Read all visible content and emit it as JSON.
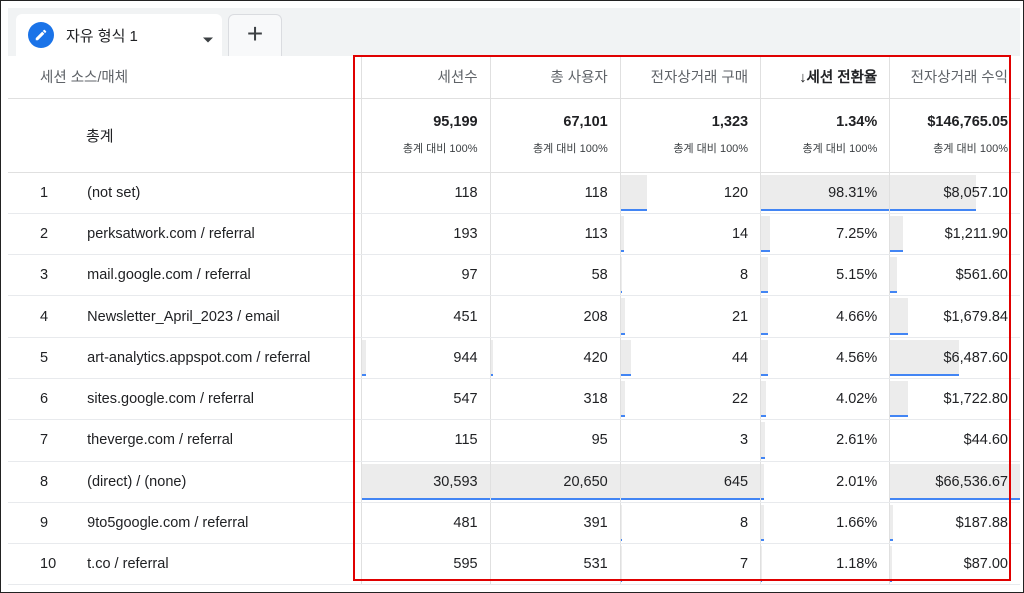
{
  "tab": {
    "label": "자유 형식 1",
    "icon": "pencil-icon",
    "add_icon": "plus-icon"
  },
  "columns": {
    "source": "세션 소스/매체",
    "sessions": "세션수",
    "users": "총 사용자",
    "purchases": "전자상거래 구매",
    "conversion": "↓세션 전환율",
    "revenue": "전자상거래 수익"
  },
  "totals": {
    "label": "총계",
    "sessions": "95,199",
    "users": "67,101",
    "purchases": "1,323",
    "conversion": "1.34%",
    "revenue": "$146,765.05",
    "sub": "총계 대비 100%"
  },
  "rows": [
    {
      "idx": "1",
      "source": "(not set)",
      "sessions": "118",
      "users": "118",
      "purchases": "120",
      "conversion": "98.31%",
      "revenue": "$8,057.10"
    },
    {
      "idx": "2",
      "source": "perksatwork.com / referral",
      "sessions": "193",
      "users": "113",
      "purchases": "14",
      "conversion": "7.25%",
      "revenue": "$1,211.90"
    },
    {
      "idx": "3",
      "source": "mail.google.com / referral",
      "sessions": "97",
      "users": "58",
      "purchases": "8",
      "conversion": "5.15%",
      "revenue": "$561.60"
    },
    {
      "idx": "4",
      "source": "Newsletter_April_2023 / email",
      "sessions": "451",
      "users": "208",
      "purchases": "21",
      "conversion": "4.66%",
      "revenue": "$1,679.84"
    },
    {
      "idx": "5",
      "source": "art-analytics.appspot.com / referral",
      "sessions": "944",
      "users": "420",
      "purchases": "44",
      "conversion": "4.56%",
      "revenue": "$6,487.60"
    },
    {
      "idx": "6",
      "source": "sites.google.com / referral",
      "sessions": "547",
      "users": "318",
      "purchases": "22",
      "conversion": "4.02%",
      "revenue": "$1,722.80"
    },
    {
      "idx": "7",
      "source": "theverge.com / referral",
      "sessions": "115",
      "users": "95",
      "purchases": "3",
      "conversion": "2.61%",
      "revenue": "$44.60"
    },
    {
      "idx": "8",
      "source": "(direct) / (none)",
      "sessions": "30,593",
      "users": "20,650",
      "purchases": "645",
      "conversion": "2.01%",
      "revenue": "$66,536.67"
    },
    {
      "idx": "9",
      "source": "9to5google.com / referral",
      "sessions": "481",
      "users": "391",
      "purchases": "8",
      "conversion": "1.66%",
      "revenue": "$187.88"
    },
    {
      "idx": "10",
      "source": "t.co / referral",
      "sessions": "595",
      "users": "531",
      "purchases": "7",
      "conversion": "1.18%",
      "revenue": "$87.00"
    }
  ],
  "bar_fractions": {
    "sessions": [
      0.0,
      0.0,
      0.0,
      0.0,
      0.03,
      0.0,
      0.0,
      1.0,
      0.0,
      0.0
    ],
    "users": [
      0.0,
      0.0,
      0.0,
      0.0,
      0.02,
      0.0,
      0.0,
      1.0,
      0.0,
      0.0
    ],
    "purchases": [
      0.19,
      0.02,
      0.01,
      0.03,
      0.07,
      0.03,
      0.0,
      1.0,
      0.01,
      0.01
    ],
    "conversion": [
      1.0,
      0.07,
      0.05,
      0.05,
      0.05,
      0.04,
      0.03,
      0.02,
      0.02,
      0.01
    ],
    "revenue": [
      0.66,
      0.1,
      0.05,
      0.14,
      0.53,
      0.14,
      0.0,
      1.0,
      0.02,
      0.01
    ]
  },
  "colors": {
    "accent": "#1a73e8",
    "bar_line": "#4285f4",
    "bar_fill": "#ececec",
    "highlight": "#e00000"
  }
}
